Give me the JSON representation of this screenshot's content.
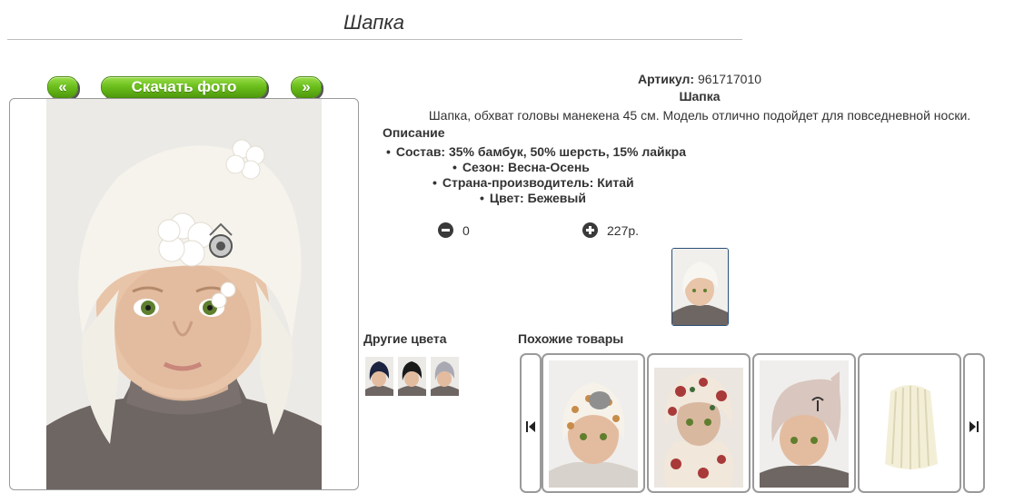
{
  "page": {
    "title": "Шапка"
  },
  "photo_nav": {
    "prev_label": "«",
    "download_label": "Скачать фото",
    "next_label": "»"
  },
  "product": {
    "article_label": "Артикул:",
    "article_value": "961717010",
    "name": "Шапка",
    "description": "Шапка, обхват головы манекена 45 см. Модель отлично подойдет для повседневной носки.",
    "description_heading": "Описание",
    "specs": [
      "Состав: 35% бамбук, 50% шерсть, 15% лайкра",
      "Сезон: Весна-Осень",
      "Страна-производитель: Китай",
      "Цвет: Бежевый"
    ]
  },
  "order": {
    "quantity": "0",
    "price": "227р."
  },
  "colors": {
    "heading": "Другие цвета",
    "swatches": [
      {
        "name": "swatch-navy",
        "color": "#1c2340"
      },
      {
        "name": "swatch-black",
        "color": "#1a1a1a"
      },
      {
        "name": "swatch-grey",
        "color": "#a9a9b3"
      }
    ]
  },
  "similar": {
    "heading": "Похожие товары"
  },
  "icons": {
    "minus": "minus-circle-icon",
    "plus": "plus-circle-icon",
    "carousel_prev": "skip-back-icon",
    "carousel_next": "skip-forward-icon"
  },
  "colors_theme": {
    "button_green": "#6cc01d",
    "frame_border": "#999999",
    "thumb_border": "#2a4f78"
  }
}
